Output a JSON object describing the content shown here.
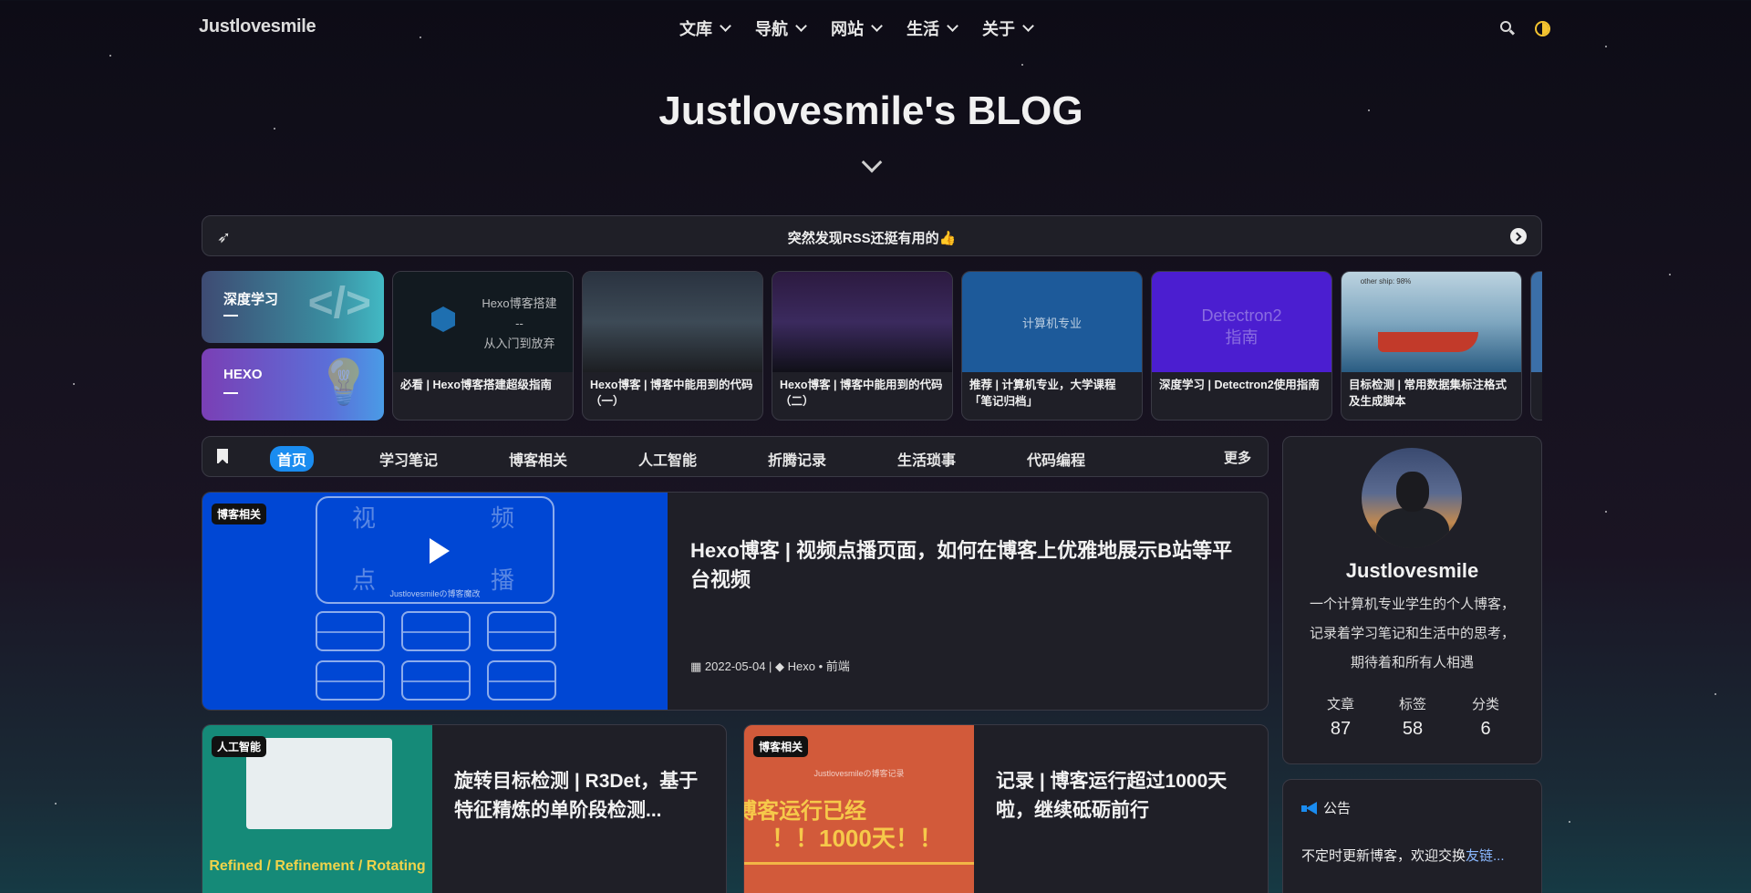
{
  "nav": {
    "logo": "Justlovesmile",
    "menu": [
      "文库",
      "导航",
      "网站",
      "生活",
      "关于"
    ]
  },
  "hero": {
    "title": "Justlovesmile's BLOG"
  },
  "notice_bar": {
    "text": "突然发现RSS还挺有用的👍"
  },
  "categories": [
    {
      "name": "深度学习",
      "icon": "laptop-code-icon"
    },
    {
      "name": "HEXO",
      "icon": "lightbulb-icon"
    }
  ],
  "recommended": [
    {
      "caption": "必看 | Hexo博客搭建超级指南",
      "thumb_text": "Hexo博客搭建\n--\n从入门到放弃"
    },
    {
      "caption": "Hexo博客 | 博客中能用到的代码（一）"
    },
    {
      "caption": "Hexo博客 | 博客中能用到的代码（二）"
    },
    {
      "caption": "推荐 | 计算机专业，大学课程「笔记归档」",
      "thumb_text": "计算机专业"
    },
    {
      "caption": "深度学习 | Detectron2使用指南",
      "thumb_text": "Detectron2\n指南"
    },
    {
      "caption": "目标检测 | 常用数据集标注格式及生成脚本",
      "thumb_text": "other ship: 98%"
    }
  ],
  "tabs": [
    "首页",
    "学习笔记",
    "博客相关",
    "人工智能",
    "折腾记录",
    "生活琐事",
    "代码编程"
  ],
  "tabs_more": "更多",
  "featured": {
    "badge": "博客相关",
    "title": "Hexo博客 | 视频点播页面，如何在博客上优雅地展示B站等平台视频",
    "date": "2022-05-04",
    "tags": "Hexo • 前端",
    "img_chars": [
      "视",
      "频",
      "点",
      "播"
    ],
    "img_sub": "Justlovesmileの博客魔改"
  },
  "posts": [
    {
      "badge": "人工智能",
      "title": "旋转目标检测 | R3Det，基于特征精炼的单阶段检测...",
      "img_text": "Refined / Refinement / Rotating"
    },
    {
      "badge": "博客相关",
      "title": "记录 | 博客运行超过1000天啦，继续砥砺前行",
      "img_text": "博客运行已经",
      "img_text2": "！！1000天！！",
      "img_sub": "Justlovesmileの博客记录"
    }
  ],
  "profile": {
    "name": "Justlovesmile",
    "desc": "一个计算机专业学生的个人博客，记录着学习笔记和生活中的思考，期待着和所有人相遇",
    "stats": [
      {
        "label": "文章",
        "value": "87"
      },
      {
        "label": "标签",
        "value": "58"
      },
      {
        "label": "分类",
        "value": "6"
      }
    ]
  },
  "announcement": {
    "heading": "公告",
    "text": "不定时更新博客，欢迎交换",
    "link": "友链..."
  },
  "colors": {
    "accent": "#1a8cf0",
    "card_bg": "#1f1f27",
    "theme_toggle": "#f4c430"
  }
}
